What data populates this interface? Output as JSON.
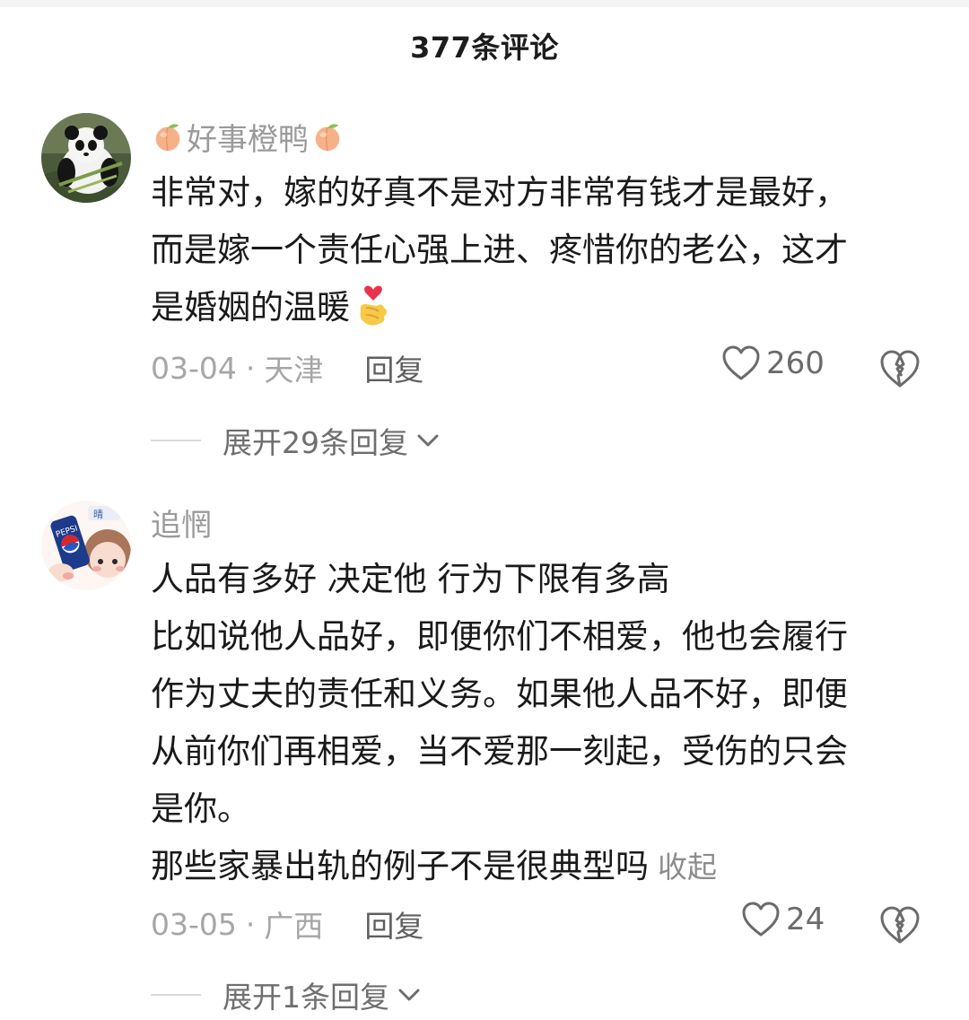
{
  "sheet": {
    "title": "377条评论"
  },
  "comments": [
    {
      "username": "好事橙鸭",
      "username_decoration_icon": "peach-icon",
      "avatar_icon": "panda-avatar",
      "lines": [
        "非常对，嫁的好真不是对方非常有钱才是最好，",
        "而是嫁一个责任心强上进、疼惜你的老公，这才",
        "是婚姻的温暖"
      ],
      "emoji_icon": "finger-heart-icon",
      "date": "03-04",
      "separator": "·",
      "location": "天津",
      "reply_label": "回复",
      "like_count": "260",
      "expand_label": "展开29条回复"
    },
    {
      "username": "追惘",
      "avatar_icon": "cartoon-pepsi-avatar",
      "lines": [
        "人品有多好 决定他 行为下限有多高",
        "比如说他人品好，即便你们不相爱，他也会履行",
        "作为丈夫的责任和义务。如果他人品不好，即便",
        "从前你们再相爱，当不爱那一刻起，受伤的只会",
        "是你。",
        "那些家暴出轨的例子不是很典型吗"
      ],
      "collapse_label": "收起",
      "date": "03-05",
      "separator": "·",
      "location": "广西",
      "reply_label": "回复",
      "like_count": "24",
      "expand_label": "展开1条回复"
    }
  ],
  "colors": {
    "text_primary": "#1a1a1a",
    "text_secondary": "#9a9a9a",
    "reply_text": "#5f5f5f",
    "like_text": "#6b6b6b",
    "peach": "#f5a97a",
    "heart_emoji": "#e8334a",
    "hand_emoji": "#f7c948"
  }
}
